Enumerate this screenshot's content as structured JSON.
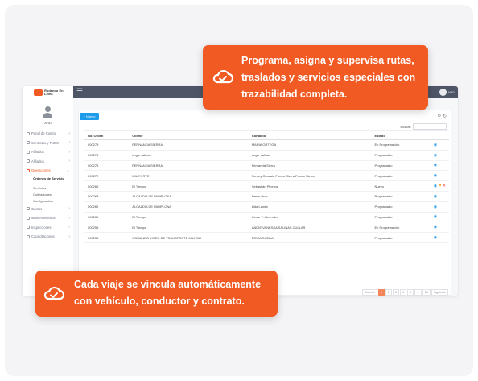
{
  "callouts": {
    "top": "Programa, asigna y supervisa rutas, traslados y servicios especiales con trazabilidad completa.",
    "bottom": "Cada viaje se vincula automáticamente con vehículo, conductor y contrato."
  },
  "topbar": {
    "user_label": "AHD"
  },
  "sidebar": {
    "logo": "Rodando En Línea",
    "username": "AHD",
    "items": [
      {
        "label": "Panel de Control",
        "icon": "dashboard-icon"
      },
      {
        "label": "Contratos y FUEC",
        "icon": "document-icon"
      },
      {
        "label": "Afiliados",
        "icon": "users-icon"
      },
      {
        "label": "Afiliados",
        "icon": "car-icon"
      },
      {
        "label": "Operaciones",
        "icon": "operations-icon",
        "active": true
      }
    ],
    "subitems": [
      "Órdenes de Servicio",
      "Servicios",
      "Cotizaciones",
      "Configuración"
    ],
    "items2": [
      {
        "label": "Gastos",
        "icon": "money-icon"
      },
      {
        "label": "Mantenimientos",
        "icon": "wrench-icon"
      },
      {
        "label": "Inspecciones",
        "icon": "checklist-icon"
      },
      {
        "label": "Capacitaciones",
        "icon": "training-icon"
      }
    ]
  },
  "toolbar": {
    "new_label": "Nuevo",
    "search_label": "Buscar:"
  },
  "table": {
    "headers": [
      "No. Orden",
      "Cliente",
      "Contacto",
      "Estado",
      ""
    ],
    "rows": [
      {
        "orden": "000275",
        "cliente": "FERNANDA SIERRA",
        "contacto": "MARIA ORTEGA",
        "estado": "En Programación"
      },
      {
        "orden": "000274",
        "cliente": "angie salinas",
        "contacto": "angie salinas",
        "estado": "Programado"
      },
      {
        "orden": "000273",
        "cliente": "FERNANDA SIERRA",
        "contacto": "Fernanda Sierra",
        "estado": "Programado"
      },
      {
        "orden": "000272",
        "cliente": "MILCY RYE",
        "contacto": "Forney Gonzalo Forero Sierra Forero Sierra",
        "estado": "Programado"
      },
      {
        "orden": "000269",
        "cliente": "El Tiempo",
        "contacto": "Sebastián Pinerus",
        "estado": "Nuevo"
      },
      {
        "orden": "000263",
        "cliente": "ALCALDIA DE PAMPLONA",
        "contacto": "karen ahoz",
        "estado": "Programado"
      },
      {
        "orden": "000262",
        "cliente": "ALCALDIA DE PAMPLONA",
        "contacto": "Lida Landa",
        "estado": "Programado"
      },
      {
        "orden": "000260",
        "cliente": "El Tiempo",
        "contacto": "Cesar F. Almendra",
        "estado": "Programado"
      },
      {
        "orden": "000259",
        "cliente": "El Tiempo",
        "contacto": "ANDIE VANESSA SALINAS CULLAR",
        "estado": "En Programación"
      },
      {
        "orden": "000258",
        "cliente": "COMANDO VISEO DE TRANSPORTE MILITAR",
        "contacto": "ERIKA RUEDA",
        "estado": "Programado"
      }
    ]
  },
  "pager": [
    "Anterior",
    "1",
    "2",
    "3",
    "4",
    "5",
    "...",
    "26",
    "Siguiente"
  ],
  "colors": {
    "accent": "#f15a22",
    "primary": "#1e9be9",
    "topbar": "#4d5567"
  }
}
